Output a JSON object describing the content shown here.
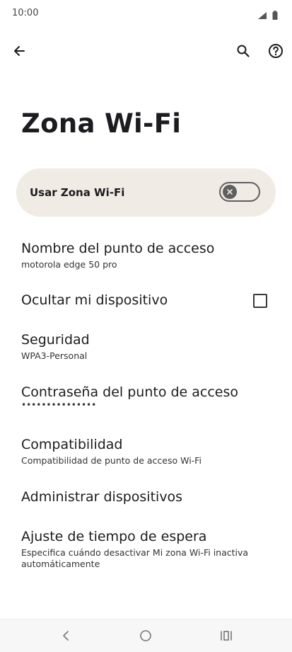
{
  "status_bar": {
    "time": "10:00"
  },
  "toolbar": {
    "back_icon": "arrow-back-icon",
    "search_icon": "search-icon",
    "help_icon": "help-icon"
  },
  "page": {
    "title": "Zona Wi-Fi"
  },
  "main_toggle": {
    "label": "Usar Zona Wi-Fi",
    "state": "off"
  },
  "settings": [
    {
      "title": "Nombre del punto de acceso",
      "subtitle": "motorola edge 50 pro"
    },
    {
      "title": "Ocultar mi dispositivo",
      "checked": false
    },
    {
      "title": "Seguridad",
      "subtitle": "WPA3-Personal"
    },
    {
      "title": "Contraseña del punto de acceso",
      "subtitle": "•••••••••••••••"
    },
    {
      "title": "Compatibilidad",
      "subtitle": "Compatibilidad de punto de acceso Wi-Fi"
    },
    {
      "title": "Administrar dispositivos"
    },
    {
      "title": "Ajuste de tiempo de espera",
      "subtitle": "Especifica cuándo desactivar Mi zona Wi-Fi inactiva automáticamente"
    }
  ],
  "nav_bar": {
    "back": "nav-back-icon",
    "home": "nav-home-icon",
    "recents": "nav-recents-icon"
  },
  "colors": {
    "card_bg": "#f0ebe5",
    "text": "#1c1b1f",
    "switch_off": "#5f5f5f"
  }
}
